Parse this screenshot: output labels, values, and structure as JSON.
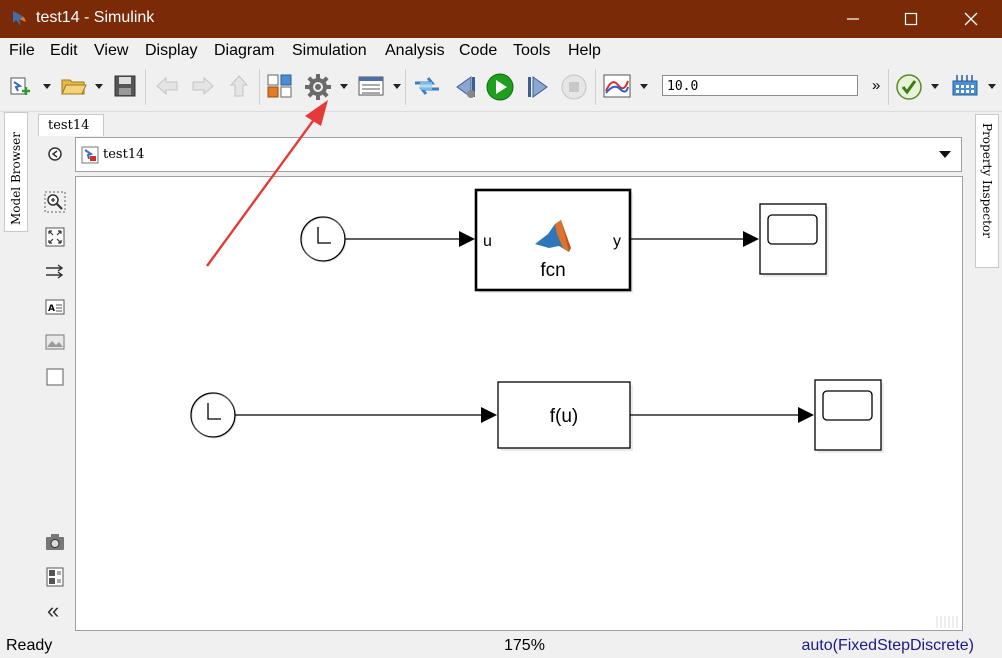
{
  "window": {
    "title": "test14 - Simulink",
    "title_bar_color": "#7a2a06",
    "controls": [
      "minimize-icon",
      "maximize-icon",
      "close-icon"
    ]
  },
  "menu": {
    "items": [
      "File",
      "Edit",
      "View",
      "Display",
      "Diagram",
      "Simulation",
      "Analysis",
      "Code",
      "Tools",
      "Help"
    ]
  },
  "toolbar": {
    "icons": [
      "new-model-icon",
      "open-folder-icon",
      "save-icon",
      "back-icon",
      "forward-icon",
      "up-icon",
      "library-browser-icon",
      "model-settings-gear-icon",
      "model-explorer-icon",
      "update-diagram-icon",
      "step-back-icon",
      "run-icon",
      "step-forward-icon",
      "stop-icon",
      "data-inspector-icon",
      "model-advisor-check-icon",
      "build-icon"
    ],
    "stop_time": "10.0",
    "more": "»",
    "run_color": "#1ea01e"
  },
  "side_tabs": {
    "left": "Model Browser",
    "right": "Property Inspector"
  },
  "document": {
    "tab": "test14",
    "breadcrumb": "test14"
  },
  "palette": {
    "icons": [
      "hide-browser-icon",
      "zoom-icon",
      "fit-view-icon",
      "route-lines-icon",
      "annotation-icon",
      "image-icon",
      "area-icon",
      "screenshot-camera-icon",
      "report-icon",
      "collapse-icon"
    ],
    "collapse_glyph": "«"
  },
  "diagram": {
    "blocks": {
      "fcn_input_port": "u",
      "fcn_output_port": "y",
      "fcn_name": "fcn",
      "fcn2_expr": "f(u)"
    }
  },
  "status": {
    "state": "Ready",
    "zoom": "175%",
    "solver": "auto(FixedStepDiscrete)"
  }
}
